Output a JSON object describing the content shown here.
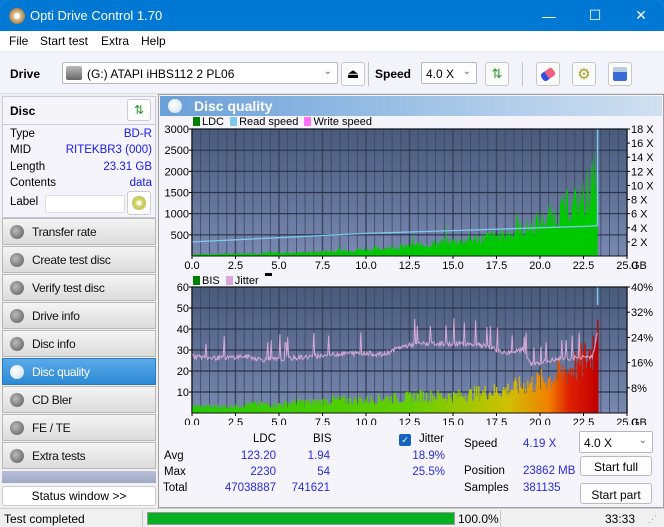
{
  "window": {
    "title": "Opti Drive Control 1.70",
    "controls": {
      "minimize": "—",
      "maximize": "☐",
      "close": "✕"
    }
  },
  "menu": [
    "File",
    "Start test",
    "Extra",
    "Help"
  ],
  "toolbar": {
    "drive_label": "Drive",
    "drive_value": "(G:)  ATAPI iHBS112  2 PL06",
    "speed_label": "Speed",
    "speed_value": "4.0 X",
    "icons": [
      "drive-icon",
      "eject-icon",
      "refresh-icon",
      "eraser-icon",
      "settings-icon",
      "save-icon"
    ]
  },
  "disc": {
    "header": "Disc",
    "fields": [
      {
        "key": "Type",
        "value": "BD-R"
      },
      {
        "key": "MID",
        "value": "RITEKBR3 (000)"
      },
      {
        "key": "Length",
        "value": "23.31 GB"
      },
      {
        "key": "Contents",
        "value": "data"
      }
    ],
    "label_key": "Label",
    "label_value": ""
  },
  "nav": [
    {
      "label": "Transfer rate",
      "active": false
    },
    {
      "label": "Create test disc",
      "active": false
    },
    {
      "label": "Verify test disc",
      "active": false
    },
    {
      "label": "Drive info",
      "active": false
    },
    {
      "label": "Disc info",
      "active": false
    },
    {
      "label": "Disc quality",
      "active": true
    },
    {
      "label": "CD Bler",
      "active": false
    },
    {
      "label": "FE / TE",
      "active": false
    },
    {
      "label": "Extra tests",
      "active": false
    }
  ],
  "status_window_button": "Status window >>",
  "panel_title": "Disc quality",
  "colors": {
    "ldc": "#00c800",
    "read_speed": "#7ec8f0",
    "write_speed": "#ff70ff",
    "bis": "#008000",
    "jitter": "#d8a8d8",
    "plot_bg_top": "#4a5a7c",
    "plot_bg_bottom": "#7080a8",
    "progress": "#06b025",
    "value_text": "#2a2ae0"
  },
  "chart_data": [
    {
      "type": "area",
      "title": "LDC / Read speed",
      "legend": [
        "LDC",
        "Read speed",
        "Write speed"
      ],
      "legend_position": "top-left",
      "xlabel": "GB",
      "x_ticks": [
        "0.0",
        "2.5",
        "5.0",
        "7.5",
        "10.0",
        "12.5",
        "15.0",
        "17.5",
        "20.0",
        "22.5",
        "25.0"
      ],
      "xlim": [
        0,
        25
      ],
      "ylim_left": [
        0,
        3000
      ],
      "y_ticks_left": [
        "500",
        "1000",
        "1500",
        "2000",
        "2500",
        "3000"
      ],
      "ylim_right": [
        0,
        18
      ],
      "y_ticks_right": [
        "2 X",
        "4 X",
        "6 X",
        "8 X",
        "10 X",
        "12 X",
        "14 X",
        "16 X",
        "18 X"
      ],
      "grid": true,
      "series": [
        {
          "name": "LDC",
          "x": [
            0,
            1,
            2,
            3,
            4,
            5,
            6,
            7,
            8,
            9,
            10,
            11,
            12,
            13,
            14,
            15,
            16,
            17,
            18,
            19,
            20,
            21,
            22,
            22.5,
            23,
            23.31
          ],
          "y": [
            40,
            50,
            55,
            70,
            70,
            80,
            85,
            100,
            120,
            150,
            170,
            190,
            230,
            280,
            330,
            380,
            420,
            480,
            560,
            680,
            880,
            1100,
            1350,
            1500,
            1800,
            2230
          ]
        },
        {
          "name": "Read speed",
          "x": [
            0,
            2.5,
            5,
            7.5,
            10,
            12.5,
            15,
            17.5,
            20,
            22.5,
            23.31
          ],
          "y": [
            2.0,
            2.3,
            2.6,
            2.9,
            3.2,
            3.4,
            3.6,
            3.8,
            4.0,
            4.2,
            4.3
          ]
        },
        {
          "name": "Write speed",
          "x": [],
          "y": []
        }
      ]
    },
    {
      "type": "area",
      "title": "BIS / Jitter",
      "legend": [
        "BIS",
        "Jitter"
      ],
      "legend_position": "top-left",
      "xlabel": "GB",
      "x_ticks": [
        "0.0",
        "2.5",
        "5.0",
        "7.5",
        "10.0",
        "12.5",
        "15.0",
        "17.5",
        "20.0",
        "22.5",
        "25.0"
      ],
      "xlim": [
        0,
        25
      ],
      "ylim_left": [
        0,
        60
      ],
      "y_ticks_left": [
        "10",
        "20",
        "30",
        "40",
        "50",
        "60"
      ],
      "ylim_right": [
        0,
        40
      ],
      "y_ticks_right": [
        "8%",
        "16%",
        "24%",
        "32%",
        "40%"
      ],
      "grid": true,
      "series": [
        {
          "name": "BIS",
          "x": [
            0,
            1,
            2,
            3,
            4,
            5,
            6,
            7,
            8,
            9,
            10,
            11,
            12,
            13,
            14,
            15,
            16,
            17,
            18,
            19,
            20,
            21,
            22,
            22.5,
            23,
            23.31
          ],
          "y": [
            3,
            3,
            3,
            4,
            4,
            4,
            5,
            5,
            6,
            6,
            6,
            7,
            7,
            8,
            8,
            8,
            9,
            10,
            11,
            13,
            15,
            18,
            22,
            25,
            30,
            54
          ]
        },
        {
          "name": "Jitter",
          "x": [
            0,
            1,
            2,
            3,
            4,
            5,
            6,
            7,
            8,
            9,
            10,
            11,
            12,
            13,
            14,
            15,
            16,
            17,
            18,
            19,
            19.5,
            20,
            21,
            22,
            23,
            23.31
          ],
          "y": [
            18,
            17.5,
            17.5,
            18,
            17,
            17,
            17.5,
            18,
            18.5,
            19,
            19,
            18.5,
            21,
            22,
            22,
            22,
            22,
            21,
            19,
            20,
            15.5,
            16,
            17,
            17.5,
            18,
            25.5
          ]
        }
      ]
    }
  ],
  "stats": {
    "col_ldc": "LDC",
    "col_bis": "BIS",
    "jitter_label": "Jitter",
    "jitter_checked": true,
    "rows": [
      {
        "label": "Avg",
        "ldc": "123.20",
        "bis": "1.94",
        "jitter": "18.9%"
      },
      {
        "label": "Max",
        "ldc": "2230",
        "bis": "54",
        "jitter": "25.5%"
      },
      {
        "label": "Total",
        "ldc": "47038887",
        "bis": "741621",
        "jitter": ""
      }
    ],
    "speed_label": "Speed",
    "speed_value": "4.19 X",
    "position_label": "Position",
    "position_value": "23862 MB",
    "samples_label": "Samples",
    "samples_value": "381135",
    "speed_select": "4.0 X",
    "start_full": "Start full",
    "start_part": "Start part"
  },
  "statusbar": {
    "status": "Test completed",
    "progress_percent": 100.0,
    "progress_text": "100.0%",
    "time": "33:33"
  }
}
